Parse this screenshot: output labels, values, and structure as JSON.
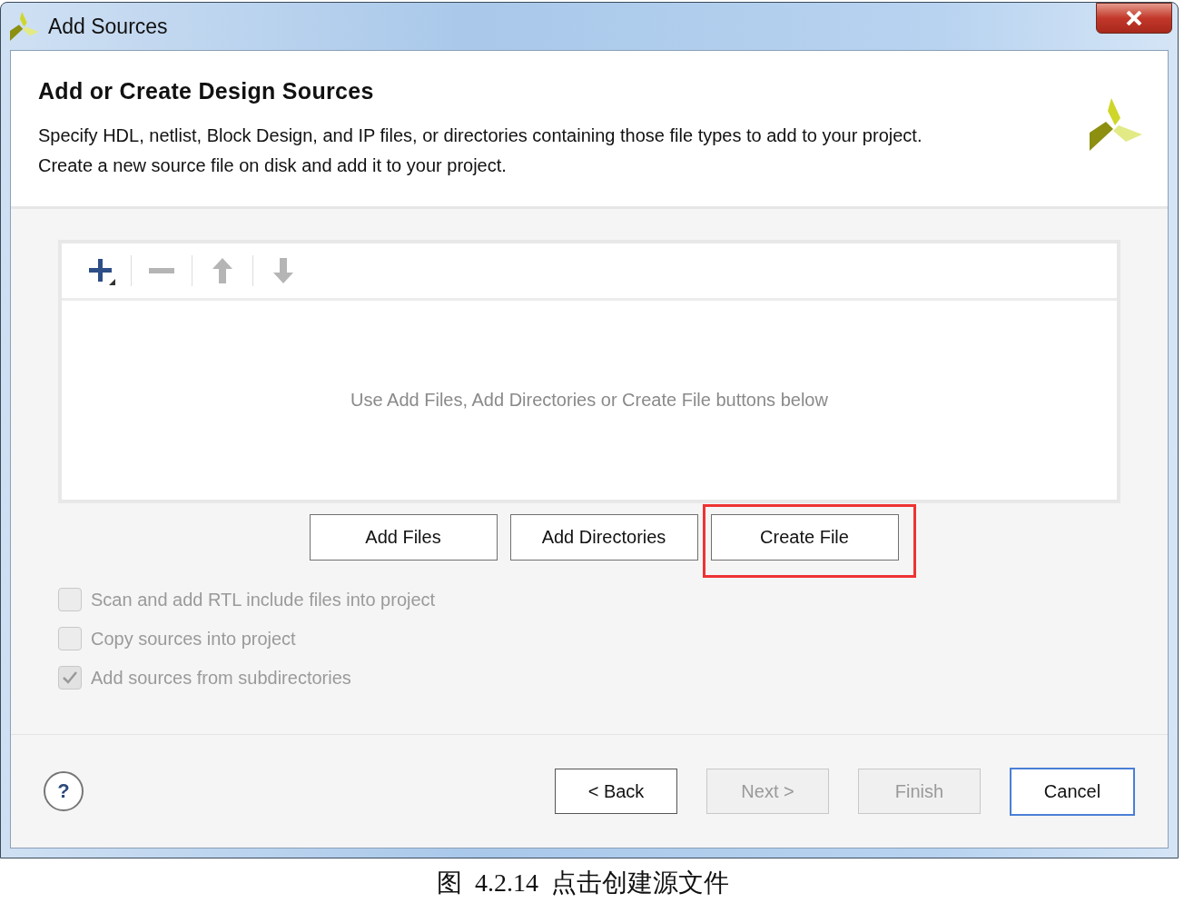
{
  "window": {
    "title": "Add Sources"
  },
  "header": {
    "title": "Add or Create Design Sources",
    "description": [
      "Specify HDL, netlist, Block Design, and IP files, or directories containing those file types to add to your project.",
      "Create a new source file on disk and add it to your project."
    ]
  },
  "file_list": {
    "toolbar": [
      {
        "kind": "add",
        "disabled": false
      },
      {
        "kind": "remove",
        "disabled": true
      },
      {
        "kind": "up",
        "disabled": true
      },
      {
        "kind": "down",
        "disabled": true
      }
    ],
    "empty_message": "Use Add Files, Add Directories or Create File buttons below"
  },
  "actions": [
    {
      "label": "Add Files",
      "highlighted": false
    },
    {
      "label": "Add Directories",
      "highlighted": false
    },
    {
      "label": "Create File",
      "highlighted": true
    }
  ],
  "options": [
    {
      "label": "Scan and add RTL include files into project",
      "checked": false,
      "disabled": true
    },
    {
      "label": "Copy sources into project",
      "checked": false,
      "disabled": true
    },
    {
      "label": "Add sources from subdirectories",
      "checked": true,
      "disabled": true
    }
  ],
  "footer": {
    "help": "?",
    "buttons": [
      {
        "label": "< Back",
        "disabled": false,
        "default": false
      },
      {
        "label": "Next >",
        "disabled": true,
        "default": false
      },
      {
        "label": "Finish",
        "disabled": true,
        "default": false
      },
      {
        "label": "Cancel",
        "disabled": false,
        "default": true
      }
    ]
  },
  "caption": "图  4.2.14  点击创建源文件"
}
